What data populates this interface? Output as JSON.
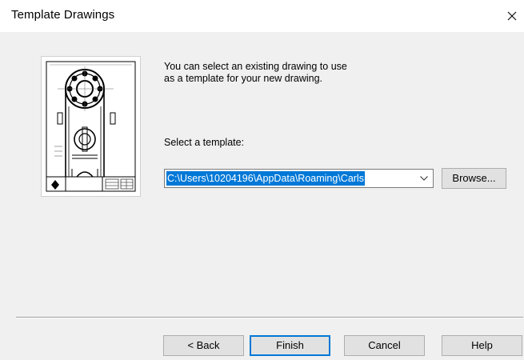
{
  "window": {
    "title": "Template Drawings",
    "close_glyph": "✕"
  },
  "description": {
    "line1": "You can select an existing drawing to use",
    "line2": "as a template for your new drawing."
  },
  "template_select": {
    "label": "Select a template:",
    "value": "C:\\Users\\10204196\\AppData\\Roaming\\Carls",
    "browse_label": "Browse...",
    "dropdown_icon": "chevron-down-icon"
  },
  "footer": {
    "back_label": "< Back",
    "finish_label": "Finish",
    "cancel_label": "Cancel",
    "help_label": "Help"
  },
  "colors": {
    "accent": "#0078d7",
    "dialog_bg": "#f0f0f0",
    "titlebar_bg": "#ffffff"
  }
}
